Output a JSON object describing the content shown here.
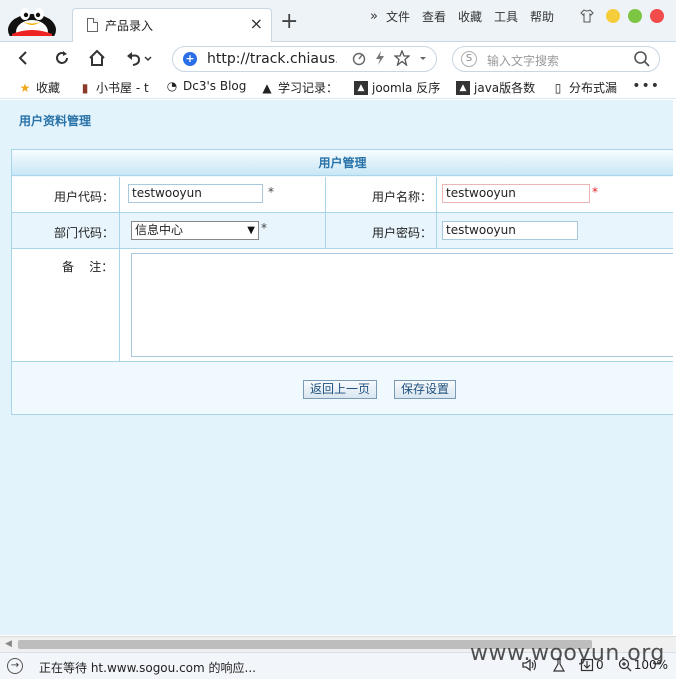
{
  "browser": {
    "tab": {
      "title": "产品录入",
      "close": "×"
    },
    "new_tab": "+",
    "menu": {
      "more": "»",
      "items": [
        "文件",
        "查看",
        "收藏",
        "工具",
        "帮助"
      ]
    },
    "url": "http://track.chiaus.",
    "search_placeholder": "输入文字搜索",
    "bookmarks": [
      {
        "label": "收藏",
        "icon": "star-icon"
      },
      {
        "label": "小书屋 - t",
        "icon": "book-icon"
      },
      {
        "label": "Dc3's Blog",
        "icon": "blog-icon"
      },
      {
        "label": "学习记录：",
        "icon": "cap-icon"
      },
      {
        "label": "joomla 反序",
        "icon": "image-icon"
      },
      {
        "label": "java版各数",
        "icon": "image-icon"
      },
      {
        "label": "分布式漏",
        "icon": "page-icon"
      }
    ],
    "bookmarks_more": "•••",
    "status_text": "正在等待 ht.www.sogou.com 的响应...",
    "status_download_count": "0",
    "zoom": "100%",
    "watermark": "www.wooyun.org",
    "colors": {
      "close": "#f24b4b",
      "maximize": "#7dc644",
      "minimize": "#f5cc3a",
      "accent": "#2a6ee8"
    }
  },
  "page": {
    "heading": "用户资料管理",
    "form_title": "用户管理",
    "user_code": {
      "label": "用户代码：",
      "value": "testwooyun",
      "required_mark": "*"
    },
    "user_name": {
      "label": "用户名称：",
      "value": "testwooyun",
      "required_mark": "*"
    },
    "dept_code": {
      "label": "部门代码：",
      "selected": "信息中心",
      "required_mark": "*"
    },
    "user_password": {
      "label": "用户密码：",
      "value": "testwooyun"
    },
    "remark": {
      "label": "备    注：",
      "value": ""
    },
    "buttons": {
      "back": "返回上一页",
      "save": "保存设置"
    }
  }
}
